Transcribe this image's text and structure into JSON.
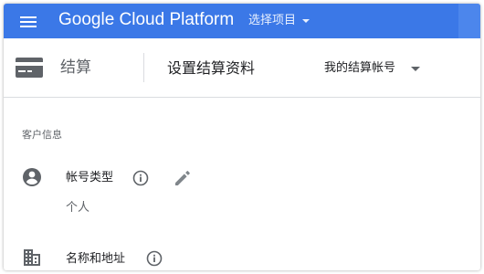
{
  "app_bar": {
    "brand": "Google Cloud Platform",
    "project_picker_label": "选择项目",
    "colors": {
      "background": "#3b78e7",
      "text": "#ffffff"
    }
  },
  "subheader": {
    "section_title": "结算",
    "page_title": "设置结算资料",
    "account_picker_label": "我的结算帐号"
  },
  "content": {
    "section_label": "客户信息",
    "fields": [
      {
        "label": "帐号类型",
        "value": "个人",
        "icon": "account-circle-icon",
        "has_info": true,
        "editable": true
      },
      {
        "label": "名称和地址",
        "icon": "business-icon",
        "has_info": true,
        "editable": false
      }
    ]
  },
  "icons": [
    "menu-icon",
    "billing-card-icon",
    "account-circle-icon",
    "info-icon",
    "edit-pencil-icon",
    "business-icon",
    "chevron-down-icon"
  ]
}
